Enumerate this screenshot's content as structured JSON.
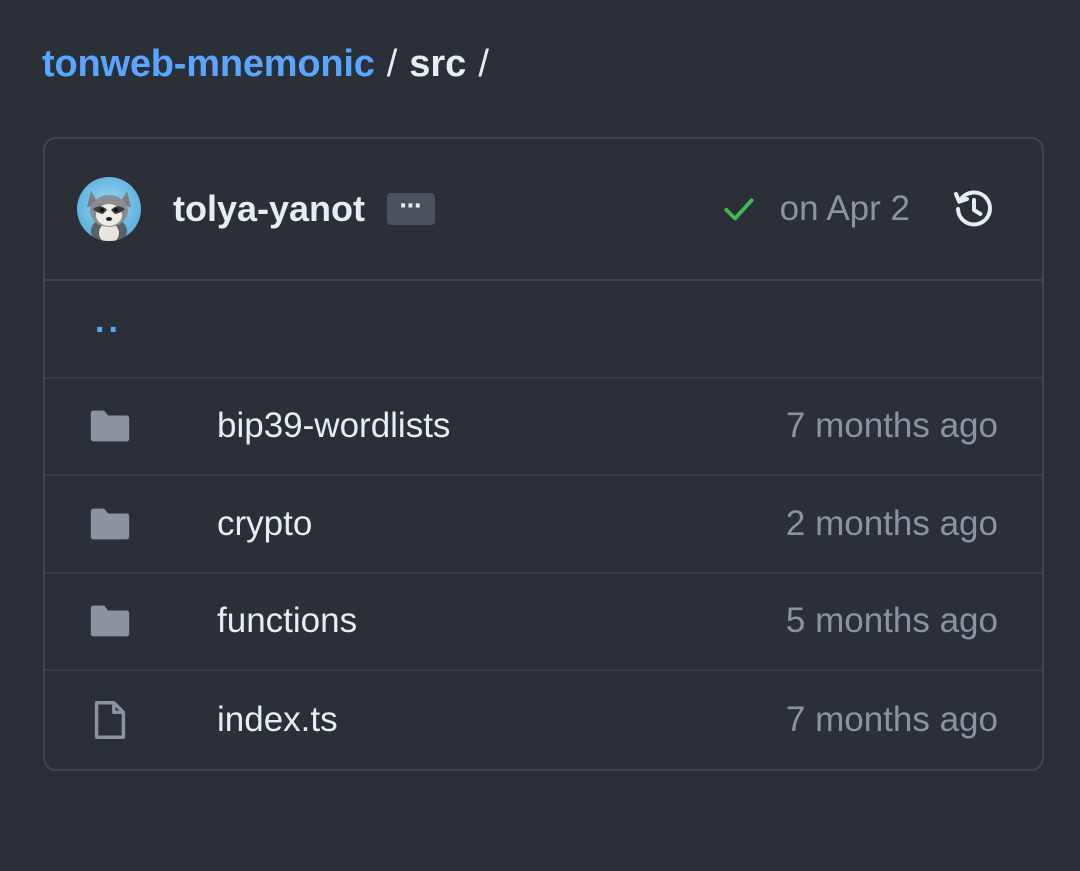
{
  "breadcrumb": {
    "repo": "tonweb-mnemonic",
    "separator": "/",
    "dir": "src",
    "trailing": "/"
  },
  "commit": {
    "author": "tolya-yanot",
    "more_label": "⋯",
    "date": "on Apr 2",
    "status": "success",
    "status_color": "#3fb950"
  },
  "parent_link": "..",
  "entries": [
    {
      "type": "folder",
      "name": "bip39-wordlists",
      "age": "7 months ago",
      "icon": "folder-icon"
    },
    {
      "type": "folder",
      "name": "crypto",
      "age": "2 months ago",
      "icon": "folder-icon"
    },
    {
      "type": "folder",
      "name": "functions",
      "age": "5 months ago",
      "icon": "folder-icon"
    },
    {
      "type": "file",
      "name": "index.ts",
      "age": "7 months ago",
      "icon": "file-icon"
    }
  ],
  "colors": {
    "background": "#2b3038",
    "accent_link": "#58a6ff",
    "muted_text": "#8b949e",
    "icon_gray": "#8b949e"
  }
}
